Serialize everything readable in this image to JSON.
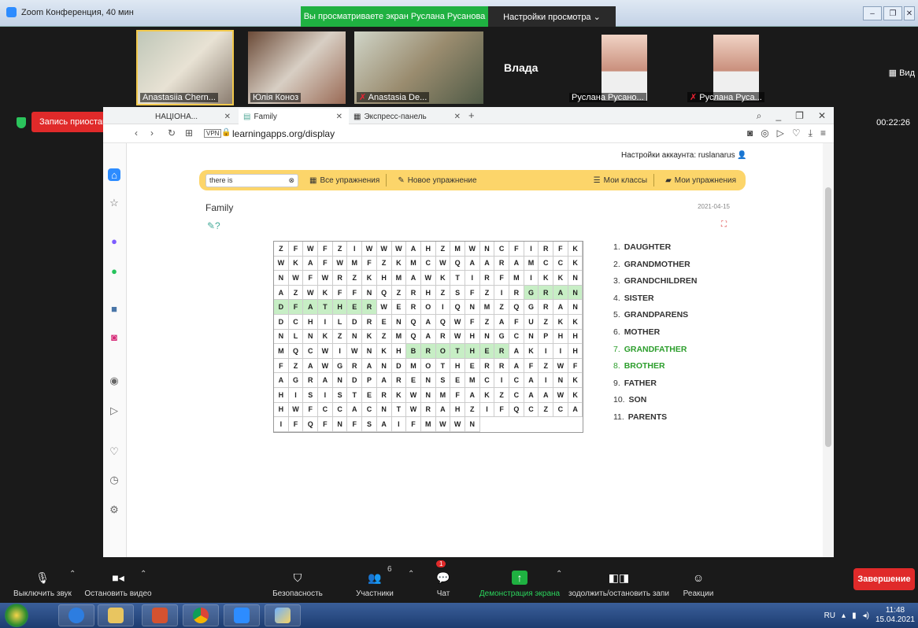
{
  "window": {
    "title": "Zoom Конференция, 40 мин",
    "share_banner": "Вы просматриваете экран Руслана Русанова",
    "view_settings": "Настройки просмотра ⌄",
    "gallery_label": "Вид"
  },
  "participants": [
    {
      "name": "Anastasiia Chern...",
      "muted": false,
      "video": true
    },
    {
      "name": "Юлія Коноз",
      "muted": false,
      "video": true
    },
    {
      "name": "Anastasia De...",
      "muted": true,
      "video": true
    },
    {
      "name": "Влада",
      "muted": false,
      "video": false
    },
    {
      "name": "Руслана Русано...",
      "muted": false,
      "video": true
    },
    {
      "name": "Руслана Руса...",
      "muted": true,
      "video": true
    }
  ],
  "recording": {
    "label": "Запись приостановлена",
    "controls": "▶ ■",
    "timer": "00:22:26"
  },
  "browser": {
    "tabs": [
      {
        "label": "НАЦІОНА..."
      },
      {
        "label": "Family"
      },
      {
        "label": "Экспресс-панель"
      }
    ],
    "vpn": "VPN",
    "url": "learningapps.org/display"
  },
  "page": {
    "account": "Настройки аккаунта: ruslanarus",
    "search_value": "there is",
    "menu": {
      "all_exercises": "Все упражнения",
      "new_exercise": "Новое упражнение",
      "my_classes": "Мои классы",
      "my_exercises": "Мои упражнения"
    },
    "title": "Family",
    "date": "2021-04-15"
  },
  "grid": {
    "rows": [
      "ZFWFZIWWWAHZMWNCFIR",
      "FKWKAFWMFZKMCWQAARA",
      "MCCKNWFWRZKHMAWKTIR",
      "FMIKKNAZWKFFNQZRHZS",
      "FZIRGRANDFATHERWERO",
      "IQNMZQGRANDCHILDREN",
      "QAQWFZAFUZKKNLNKZNK",
      "ZMQARWHNGCNPHHMQCWI",
      "WNKHBROTHERAKIIHFZA",
      "WGRANDMOTHERRAFZWFA",
      "GRANDPARENSEMCICAIN",
      "KHISISTERKWNMFAKZCA",
      "AWKHWFCCACNTWRAHZIF",
      "QCZCAIFQFNFSAIFMWWN"
    ],
    "highlights": [
      {
        "row": 4,
        "start": 4,
        "end": 14
      },
      {
        "row": 8,
        "start": 4,
        "end": 10
      }
    ]
  },
  "words": [
    {
      "n": "1.",
      "text": "DAUGHTER",
      "found": false
    },
    {
      "n": "2.",
      "text": "GRANDMOTHER",
      "found": false
    },
    {
      "n": "3.",
      "text": "GRANDCHILDREN",
      "found": false
    },
    {
      "n": "4.",
      "text": "SISTER",
      "found": false
    },
    {
      "n": "5.",
      "text": "GRANDPARENS",
      "found": false
    },
    {
      "n": "6.",
      "text": "MOTHER",
      "found": false
    },
    {
      "n": "7.",
      "text": "GRANDFATHER",
      "found": true
    },
    {
      "n": "8.",
      "text": "BROTHER",
      "found": true
    },
    {
      "n": "9.",
      "text": "FATHER",
      "found": false
    },
    {
      "n": "10.",
      "text": "SON",
      "found": false
    },
    {
      "n": "11.",
      "text": "PARENTS",
      "found": false
    }
  ],
  "controls": {
    "mute": "Выключить звук",
    "stop_video": "Остановить видео",
    "security": "Безопасность",
    "participants": "Участники",
    "participants_count": "6",
    "chat": "Чат",
    "chat_badge": "1",
    "share": "Демонстрация экрана",
    "record": "зодолжить/остановить запи",
    "reactions": "Реакции",
    "end": "Завершение"
  },
  "taskbar": {
    "lang": "RU",
    "time": "11:48",
    "date": "15.04.2021"
  },
  "colors": {
    "zoom_green": "#1fb141",
    "end_red": "#e02a2a",
    "menu_yellow": "#fcd56a",
    "found_green": "#2c9e2c"
  }
}
